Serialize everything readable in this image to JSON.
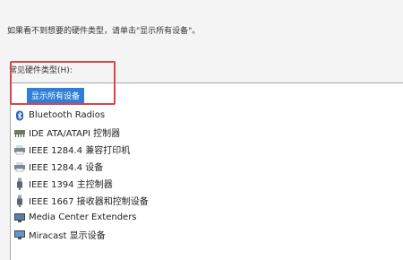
{
  "instruction_text": "如果看不到想要的硬件类型，请单击\"显示所有设备\"。",
  "list_label": "常见硬件类型(H):",
  "items": [
    {
      "label": "显示所有设备",
      "icon": "none",
      "selected": true
    },
    {
      "label": "Bluetooth Radios",
      "icon": "bluetooth-icon"
    },
    {
      "label": "IDE ATA/ATAPI 控制器",
      "icon": "ide-controller-icon"
    },
    {
      "label": "IEEE 1284.4 兼容打印机",
      "icon": "printer-icon"
    },
    {
      "label": "IEEE 1284.4 设备",
      "icon": "printer-icon"
    },
    {
      "label": "IEEE 1394 主控制器",
      "icon": "usb-plug-icon"
    },
    {
      "label": "IEEE 1667 接收器和控制设备",
      "icon": "usb-plug-icon"
    },
    {
      "label": "Media Center Extenders",
      "icon": "monitor-icon"
    },
    {
      "label": "Miracast 显示设备",
      "icon": "monitor-icon"
    }
  ],
  "colors": {
    "selection": "#2f7fd8",
    "highlight_border": "#d9454b"
  }
}
